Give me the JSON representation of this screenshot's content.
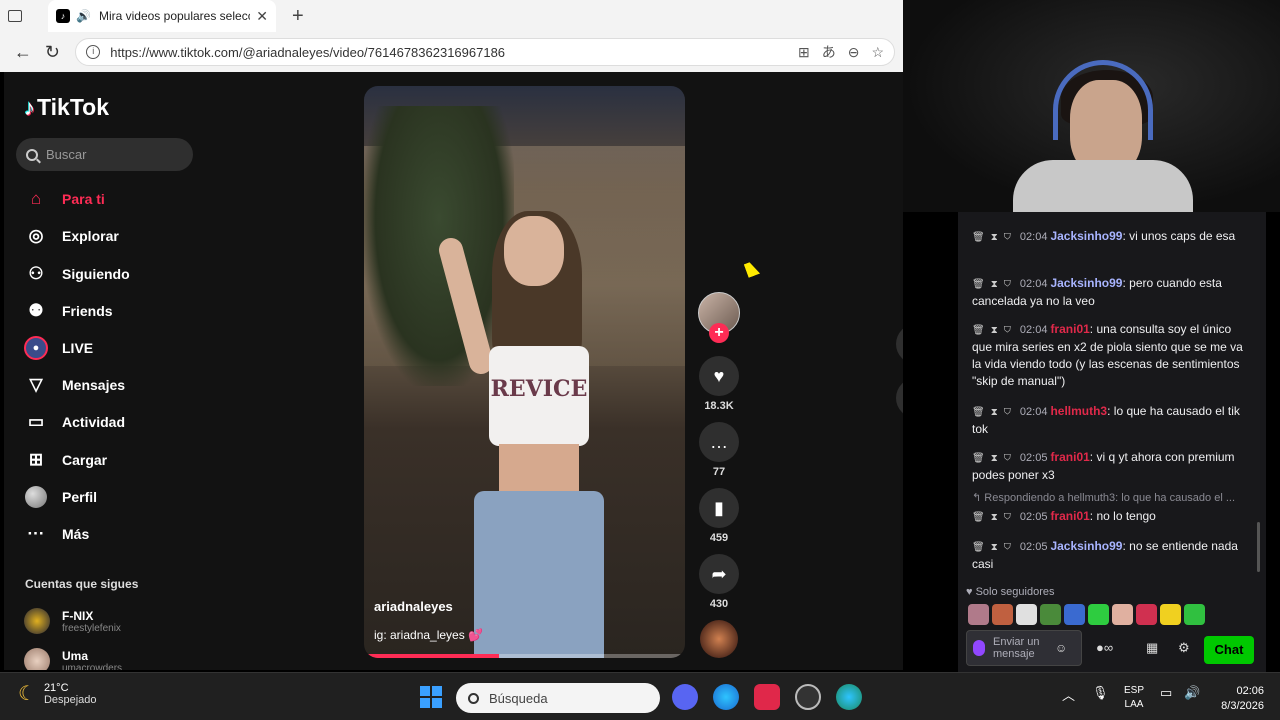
{
  "browser": {
    "tab_title": "Mira videos populares selecci",
    "url": "https://www.tiktok.com/@ariadnaleyes/video/7614678362316967186"
  },
  "tiktok": {
    "logo": "TikTok",
    "search_placeholder": "Buscar",
    "nav": [
      {
        "label": "Para ti",
        "icon": "home-icon"
      },
      {
        "label": "Explorar",
        "icon": "compass-icon"
      },
      {
        "label": "Siguiendo",
        "icon": "following-icon"
      },
      {
        "label": "Friends",
        "icon": "friends-icon"
      },
      {
        "label": "LIVE",
        "icon": "live-icon"
      },
      {
        "label": "Mensajes",
        "icon": "send-icon"
      },
      {
        "label": "Actividad",
        "icon": "activity-icon"
      },
      {
        "label": "Cargar",
        "icon": "upload-icon"
      },
      {
        "label": "Perfil",
        "icon": "profile-avatar"
      },
      {
        "label": "Más",
        "icon": "more-icon"
      }
    ],
    "following_title": "Cuentas que sigues",
    "following": [
      {
        "name": "F-NIX",
        "handle": "freestylefenix"
      },
      {
        "name": "Uma",
        "handle": "umacrowders"
      }
    ],
    "video": {
      "username": "ariadnaleyes",
      "caption": "ig: ariadna_leyes 💕",
      "shirt_text": "REVICE",
      "progress": 0.42
    },
    "actions": {
      "likes": "18.3K",
      "comments": "77",
      "saves": "459",
      "shares": "430"
    }
  },
  "chat": {
    "messages": [
      {
        "time": "02:04",
        "user": "Jacksinho99",
        "color": "#a8b4ff",
        "text": "vi unos caps de esa"
      },
      {
        "time": "02:04",
        "user": "Jacksinho99",
        "color": "#a8b4ff",
        "text": "pero cuando esta cancelada ya no la veo"
      },
      {
        "time": "02:04",
        "user": "frani01",
        "color": "#e0294a",
        "text": "una consulta soy el único que mira series en x2 de piola siento que se me va la vida viendo todo (y las escenas de sentimientos \"skip de manual\")"
      },
      {
        "time": "02:04",
        "user": "hellmuth3",
        "color": "#e0294a",
        "text": "lo que ha causado el tik tok"
      },
      {
        "time": "02:05",
        "user": "frani01",
        "color": "#e0294a",
        "text": "vi q yt ahora con premium podes poner x3"
      },
      {
        "time": "02:05",
        "user": "frani01",
        "color": "#e0294a",
        "text": "no lo tengo"
      },
      {
        "time": "02:05",
        "user": "Jacksinho99",
        "color": "#a8b4ff",
        "text": "no se entiende nada casi"
      }
    ],
    "reply_text": "↰ Respondiendo a hellmuth3: lo que ha causado el ...",
    "followers_only": "♥ Solo seguidores",
    "input_placeholder": "Enviar un mensaje",
    "chat_button": "Chat"
  },
  "taskbar": {
    "temp": "21°C",
    "weather": "Despejado",
    "search": "Búsqueda",
    "lang1": "ESP",
    "lang2": "LAA",
    "time": "02:06",
    "date": "8/3/2026"
  }
}
